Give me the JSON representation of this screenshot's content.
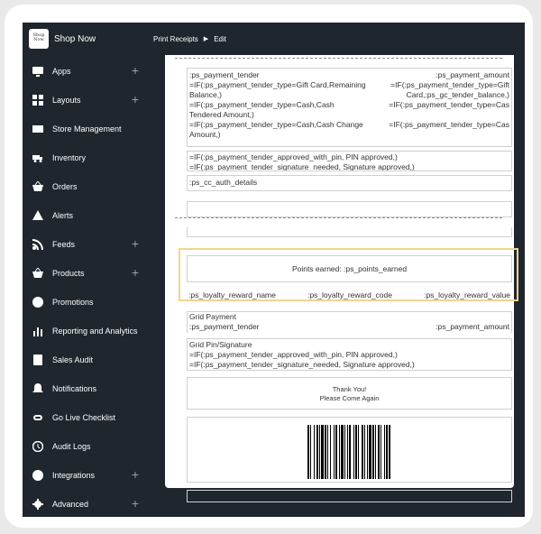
{
  "app": {
    "name": "Shop Now",
    "logo_text": "Shop Now"
  },
  "breadcrumb": {
    "section": "Print Receipts",
    "page": "Edit"
  },
  "sidebar": {
    "items": [
      {
        "label": "Apps",
        "icon": "apps-icon",
        "expandable": true
      },
      {
        "label": "Layouts",
        "icon": "layouts-icon",
        "expandable": true
      },
      {
        "label": "Store Management",
        "icon": "store-icon",
        "expandable": false
      },
      {
        "label": "Inventory",
        "icon": "truck-icon",
        "expandable": false
      },
      {
        "label": "Orders",
        "icon": "basket-icon",
        "expandable": false
      },
      {
        "label": "Alerts",
        "icon": "warning-icon",
        "expandable": false
      },
      {
        "label": "Feeds",
        "icon": "rss-icon",
        "expandable": true
      },
      {
        "label": "Products",
        "icon": "basket-icon",
        "expandable": true
      },
      {
        "label": "Promotions",
        "icon": "badge-icon",
        "expandable": false
      },
      {
        "label": "Reporting and Analytics",
        "icon": "bar-chart-icon",
        "expandable": false
      },
      {
        "label": "Sales Audit",
        "icon": "receipt-icon",
        "expandable": false
      },
      {
        "label": "Notifications",
        "icon": "bell-icon",
        "expandable": false
      },
      {
        "label": "Go Live Checklist",
        "icon": "link-icon",
        "expandable": false
      },
      {
        "label": "Audit Logs",
        "icon": "history-icon",
        "expandable": false
      },
      {
        "label": "Integrations",
        "icon": "integrations-icon",
        "expandable": true
      },
      {
        "label": "Advanced",
        "icon": "gear-icon",
        "expandable": true
      }
    ]
  },
  "receipt": {
    "payment_block": {
      "rows": [
        [
          ":ps_payment_tender",
          ":ps_payment_amount"
        ],
        [
          "=IF(:ps_payment_tender_type=Gift Card,Remaining",
          "=IF(:ps_payment_tender_type=Gift"
        ],
        [
          "Balance,)",
          "Card,:ps_gc_tender_balance,)"
        ],
        [
          "=IF(:ps_payment_tender_type=Cash,Cash",
          "=IF(:ps_payment_tender_type=Cas"
        ],
        [
          "Tendered Amount,)",
          ""
        ],
        [
          "=IF(:ps_payment_tender_type=Cash,Cash Change",
          "=IF(:ps_payment_tender_type=Cas"
        ],
        [
          "Amount,)",
          ""
        ]
      ]
    },
    "approval_block": {
      "line1": "=IF(:ps_payment_tender_approved_with_pin, PIN approved,)",
      "line2": "=IF(:ps_payment_tender_signature_needed, Signature approved,)"
    },
    "cc_auth": ":ps_cc_auth_details",
    "points_earned": "Points earned: :ps_points_earned",
    "loyalty": {
      "name": ":ps_loyalty_reward_name",
      "code": ":ps_loyalty_reward_code",
      "value": ":ps_loyalty_reward_value"
    },
    "grid_payment": {
      "title": "Grid Payment",
      "tender": ":ps_payment_tender",
      "amount": ":ps_payment_amount"
    },
    "grid_pin": {
      "title": "Grid Pin/Signature",
      "line1": "=IF(:ps_payment_tender_approved_with_pin, PIN approved,)",
      "line2": "=IF(:ps_payment_tender_signature_needed, Signature approved,)"
    },
    "thanks": {
      "line1": "Thank You!",
      "line2": "Please Come Again"
    }
  },
  "colors": {
    "sidebar_bg": "#1f262d",
    "highlight": "#f1d590"
  }
}
